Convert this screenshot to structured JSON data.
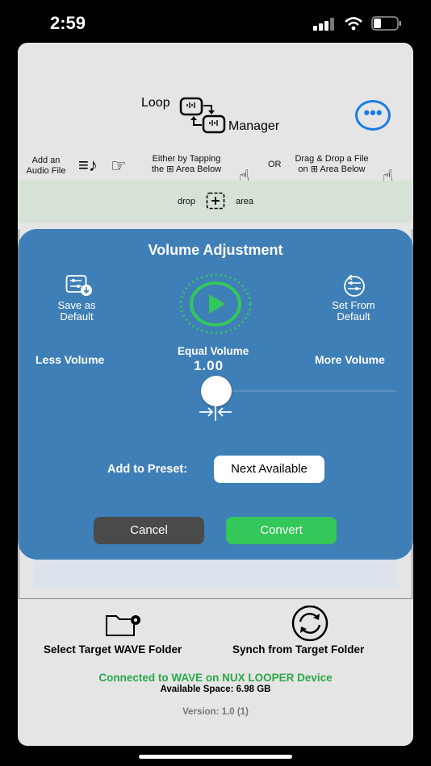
{
  "status_bar": {
    "time": "2:59"
  },
  "header": {
    "title_part1": "Loop",
    "title_part2": "Manager",
    "more_icon": "ellipsis-circle-icon"
  },
  "instructions": {
    "add_audio": "Add an Audio File",
    "add_audio_line1": "Add an",
    "add_audio_line2": "Audio File",
    "tap_line1": "Either by Tapping",
    "tap_line2_a": "the",
    "tap_line2_b": "Area Below",
    "or": "OR",
    "drag_line1": "Drag & Drop a File",
    "drag_line2_a": "on",
    "drag_line2_b": "Area Below"
  },
  "drop_area": {
    "left": "drop",
    "right": "area"
  },
  "dialog": {
    "title": "Volume Adjustment",
    "save_default_line1": "Save as",
    "save_default_line2": "Default",
    "set_default_line1": "Set From",
    "set_default_line2": "Default",
    "less_volume": "Less Volume",
    "equal_volume": "Equal Volume",
    "more_volume": "More Volume",
    "volume_value": "1.00",
    "volume_level": 0,
    "preset_label": "Add to Preset:",
    "preset_value": "Next Available",
    "cancel": "Cancel",
    "convert": "Convert"
  },
  "footer": {
    "select_folder": "Select Target WAVE Folder",
    "synch_folder": "Synch from Target Folder",
    "connected": "Connected to WAVE on NUX LOOPER Device",
    "available_space": "Available Space: 6.98 GB",
    "version": "Version: 1.0 (1)"
  },
  "colors": {
    "accent_blue": "#1a7be6",
    "dialog_blue": "#3f7fb7",
    "convert_green": "#34c759",
    "connected_green": "#2aa84a",
    "cancel_gray": "#4a4a4a"
  }
}
